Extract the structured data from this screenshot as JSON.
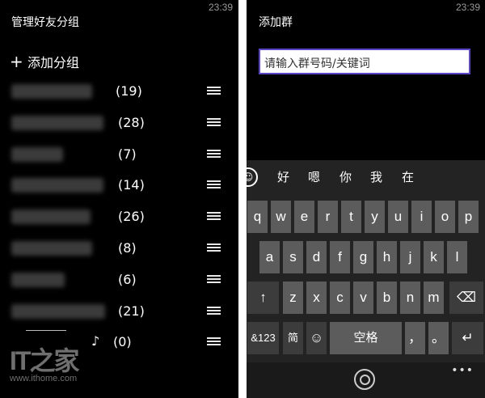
{
  "left": {
    "time": "23:39",
    "title": "管理好友分组",
    "add_group": "添加分组",
    "groups": [
      {
        "count": "(19)"
      },
      {
        "count": "(28)"
      },
      {
        "count": "(7)"
      },
      {
        "count": "(14)"
      },
      {
        "count": "(26)"
      },
      {
        "count": "(8)"
      },
      {
        "count": "(6)"
      },
      {
        "count": "(21)"
      },
      {
        "count": "(0)"
      }
    ],
    "note_icon": "♪"
  },
  "watermark": {
    "logo": "IT之家",
    "url": "www.ithome.com"
  },
  "right": {
    "time": "23:39",
    "title": "添加群",
    "search_placeholder": "请输入群号码/关键词",
    "suggestions": [
      "好",
      "嗯",
      "你",
      "我",
      "在"
    ],
    "rows": [
      [
        "q",
        "w",
        "e",
        "r",
        "t",
        "y",
        "u",
        "i",
        "o",
        "p"
      ],
      [
        "a",
        "s",
        "d",
        "f",
        "g",
        "h",
        "j",
        "k",
        "l"
      ],
      [
        "z",
        "x",
        "c",
        "v",
        "b",
        "n",
        "m"
      ]
    ],
    "shift": "↑",
    "backspace": "⌫",
    "num_key": "&123",
    "lang_key": "简",
    "emoji_key": "☺",
    "space_key": "空格",
    "comma_key": "，",
    "period_key": "。",
    "enter_key": "↵",
    "more": "•••"
  },
  "colors": {
    "background": "#000000",
    "input_border": "#5a46c8",
    "key": "#5c5c5c"
  }
}
